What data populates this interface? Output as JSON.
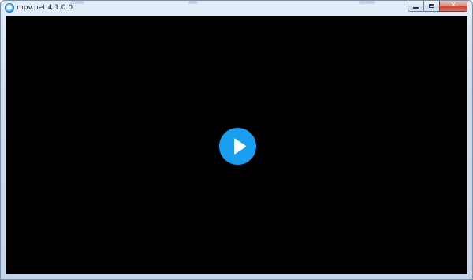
{
  "window": {
    "title": "mpv.net 4.1.0.0",
    "app_icon": "mpv-app-icon",
    "controls": {
      "minimize_icon": "minimize-icon",
      "maximize_icon": "maximize-icon",
      "close_icon": "close-icon",
      "close_glyph": "✕"
    }
  },
  "player": {
    "background_color": "#000000",
    "play_button_icon": "play-icon",
    "play_button_color": "#1a9ff0"
  }
}
